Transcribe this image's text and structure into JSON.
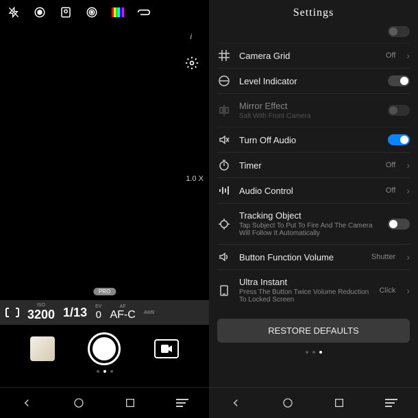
{
  "camera": {
    "info_indicator": "i",
    "zoom": "1.0 X",
    "pro_badge": "PRO",
    "iso_label": "ISO",
    "iso_value": "3200",
    "shutter_value": "1/13",
    "ev_label": "EV",
    "ev_value": "0",
    "af_label": "AF",
    "af_value": "AF-C",
    "awb_label": "AWB"
  },
  "settings": {
    "title": "Settings",
    "rows": [
      {
        "key": "grid",
        "title": "Camera Grid",
        "value": "Off",
        "type": "link"
      },
      {
        "key": "level",
        "title": "Level Indicator",
        "type": "toggle",
        "on": false
      },
      {
        "key": "mirror",
        "title": "Mirror Effect",
        "subtitle": "Salt With Front Camera",
        "type": "toggle",
        "on": false,
        "disabled": true
      },
      {
        "key": "audio",
        "title": "Turn Off Audio",
        "type": "toggle",
        "on": true
      },
      {
        "key": "timer",
        "title": "Timer",
        "value": "Off",
        "type": "link"
      },
      {
        "key": "audioctl",
        "title": "Audio Control",
        "value": "Off",
        "type": "link"
      },
      {
        "key": "tracking",
        "title": "Tracking Object",
        "subtitle": "Tap Subject To Put To Fire And The Camera Will Follow It Automatically",
        "type": "toggle",
        "on": false
      },
      {
        "key": "button",
        "title": "Button Function Volume",
        "value": "Shutter",
        "type": "link"
      },
      {
        "key": "ultra",
        "title": "Ultra Instant",
        "subtitle": "Press The Button Twice Volume Reduction To Locked Screen",
        "value": "Click",
        "type": "link"
      }
    ],
    "restore": "RESTORE DEFAULTS"
  }
}
